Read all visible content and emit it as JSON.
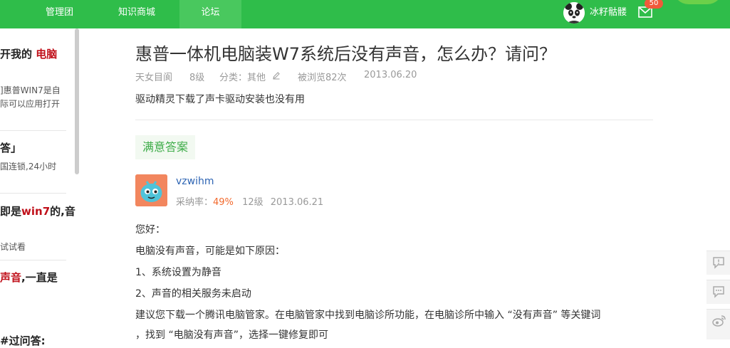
{
  "nav": {
    "items": [
      {
        "label": "管理团"
      },
      {
        "label": "知识商城"
      },
      {
        "label": "论坛"
      }
    ],
    "username": "冰籽骷髅",
    "mail_count": "50"
  },
  "sidebar": {
    "item1_title_prefix": "开我的",
    "item1_title_red": "电脑",
    "item1_desc_line1": "]惠普WIN7是自",
    "item1_desc_line2": "际可以应用打开",
    "item2_title": "答」",
    "item2_desc": "国连锁,24小时",
    "item3_title_prefix": "即是",
    "item3_title_red": "win7",
    "item3_title_suffix": "的,音",
    "item3_desc": "试试看",
    "item4_title_red": "声音",
    "item4_title_suffix": ",一直是",
    "item5_title": "#过问答:"
  },
  "question": {
    "title": "惠普一体机电脑装W7系统后没有声音，怎么办？请问？",
    "author": "天女目阆",
    "level": "8级",
    "category": "分类：其他",
    "views": "被浏览82次",
    "date": "2013.06.20",
    "description": "驱动精灵下载了声卡驱动安装也没有用"
  },
  "answer": {
    "badge": "满意答案",
    "username": "vzwihm",
    "rate_label": "采纳率：",
    "rate_value": "49%",
    "level": "12级",
    "date": "2013.06.21",
    "lines": [
      "您好：",
      "电脑没有声音，可能是如下原因：",
      "1、系统设置为静音",
      "2、声音的相关服务未启动",
      "建议您下载一个腾讯电脑管家。在电脑管家中找到电脑诊所功能，在电脑诊所中输入 “没有声音” 等关键词",
      "，找到 “电脑没有声音”，选择一键修复即可"
    ]
  },
  "float_icons": [
    "feedback-icon",
    "comment-icon",
    "weibo-icon"
  ],
  "colors": {
    "nav_bg": "#2fbd4a",
    "accent_green": "#3dac48",
    "link_blue": "#2d64b3",
    "rate_orange": "#f2692c",
    "red_keyword": "#c0101a"
  }
}
